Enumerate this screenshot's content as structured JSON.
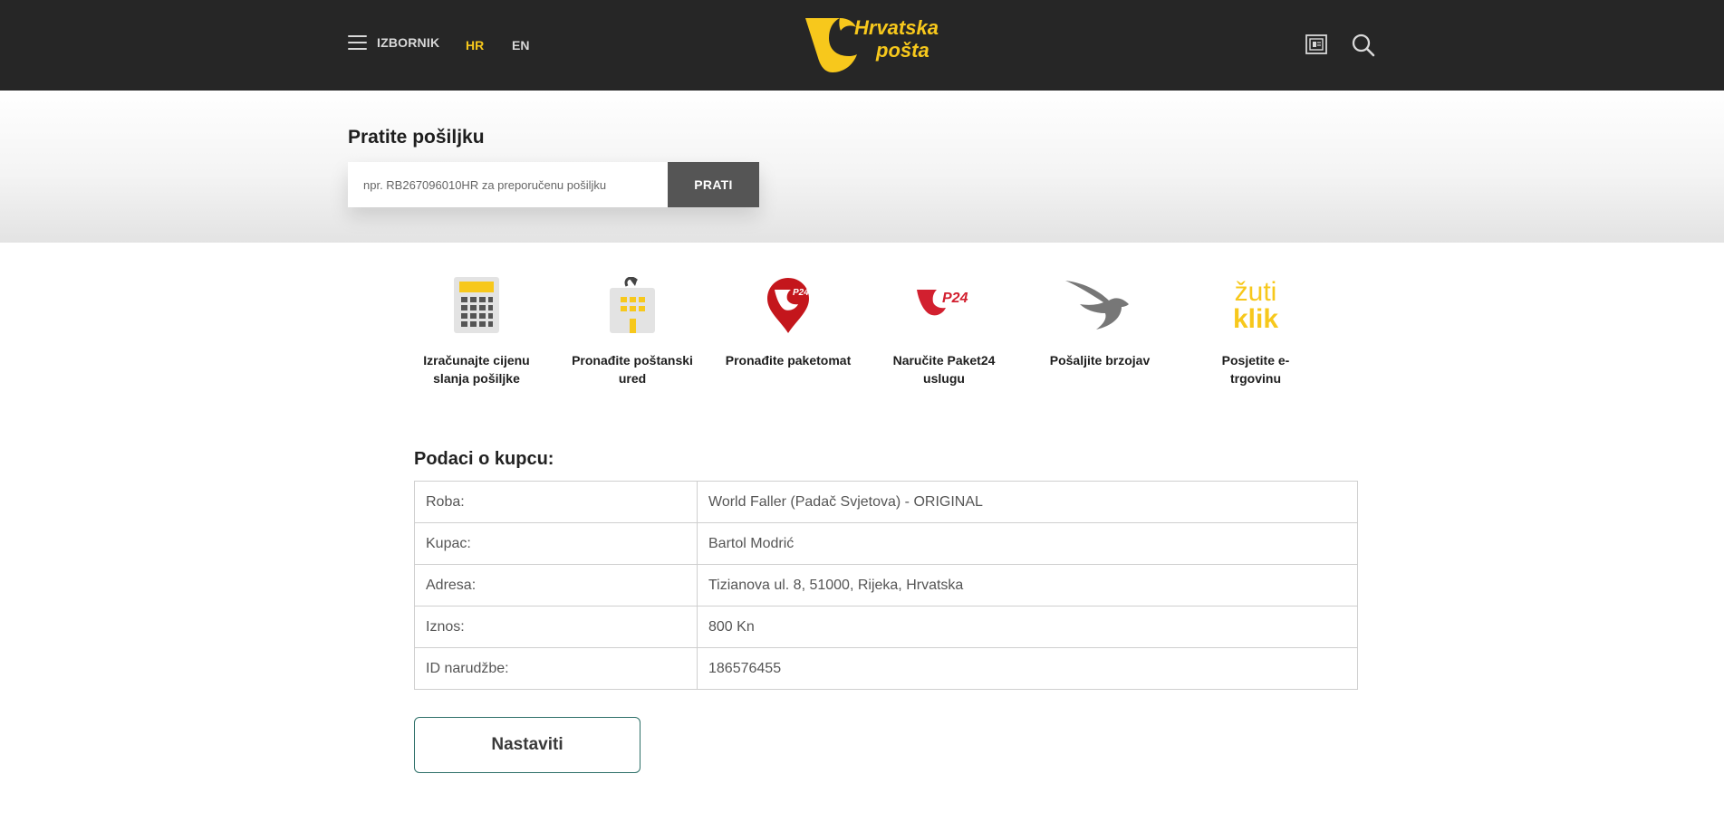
{
  "header": {
    "menu_label": "IZBORNIK",
    "languages": [
      {
        "label": "HR",
        "active": true
      },
      {
        "label": "EN",
        "active": false
      }
    ],
    "logo": {
      "line1": "Hrvatska",
      "line2": "pošta"
    },
    "icons": [
      "newspaper-icon",
      "search-icon"
    ]
  },
  "tracking": {
    "title": "Pratite pošiljku",
    "placeholder": "npr. RB267096010HR za preporučenu pošiljku",
    "value": "",
    "button_label": "PRATI"
  },
  "quick_links": [
    {
      "label": "Izračunajte cijenu slanja pošiljke",
      "icon": "calculator-icon"
    },
    {
      "label": "Pronađite poštanski ured",
      "icon": "post-office-icon"
    },
    {
      "label": "Pronađite paketomat",
      "icon": "parcel-locker-pin-icon"
    },
    {
      "label": "Naručite Paket24 uslugu",
      "icon": "paket24-icon"
    },
    {
      "label": "Pošaljite brzojav",
      "icon": "bird-icon"
    },
    {
      "label": "Posjetite e-trgovinu",
      "icon": "zuti-klik-icon",
      "logo_text_top": "žuti",
      "logo_text_bottom": "klik"
    }
  ],
  "customer": {
    "title": "Podaci o kupcu:",
    "rows": [
      {
        "label": "Roba:",
        "value": "World Faller (Padač Svjetova) - ORIGINAL"
      },
      {
        "label": "Kupac:",
        "value": "Bartol Modrić"
      },
      {
        "label": "Adresa:",
        "value": "Tizianova ul. 8, 51000, Rijeka, Hrvatska"
      },
      {
        "label": "Iznos:",
        "value": "800 Kn"
      },
      {
        "label": "ID narudžbe:",
        "value": "186576455"
      }
    ]
  },
  "continue_label": "Nastaviti",
  "colors": {
    "header_bg": "#262626",
    "brand_yellow": "#f7c81c",
    "track_button": "#555555",
    "paket24_red": "#d2202f",
    "continue_border": "#2e7069"
  }
}
